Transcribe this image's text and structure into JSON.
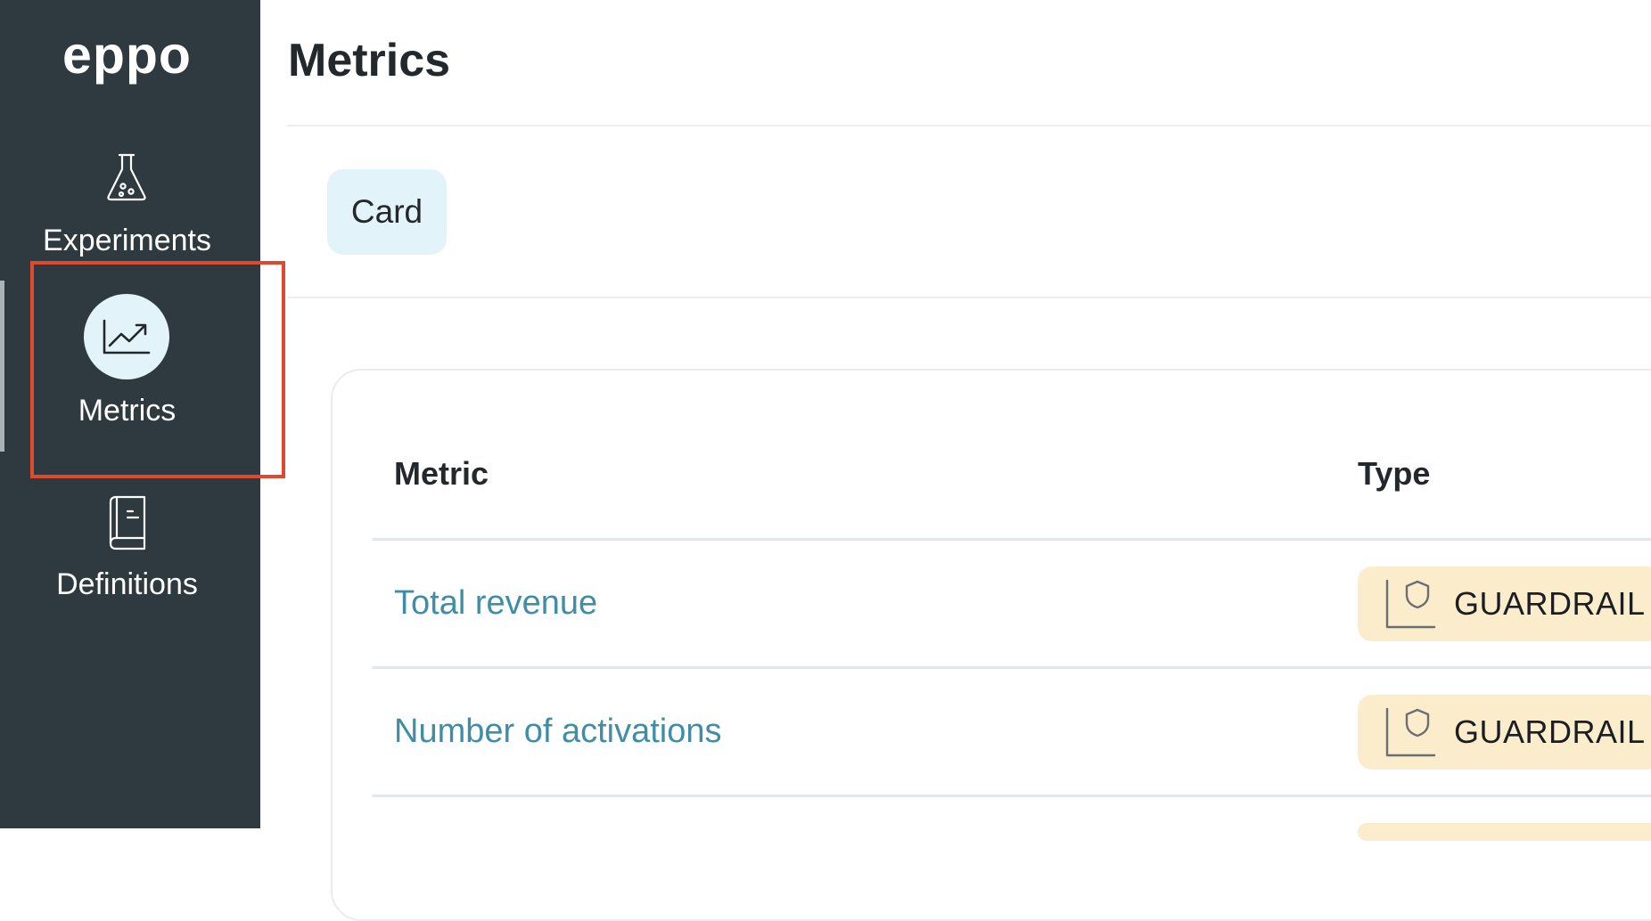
{
  "app": {
    "logo_text": "eppo"
  },
  "sidebar": {
    "items": [
      {
        "label": "Experiments",
        "icon": "flask-icon",
        "active": false
      },
      {
        "label": "Metrics",
        "icon": "trending-chart-icon",
        "active": true
      },
      {
        "label": "Definitions",
        "icon": "book-icon",
        "active": false
      }
    ]
  },
  "header": {
    "title": "Metrics"
  },
  "view_toggle": {
    "label": "Card"
  },
  "table": {
    "columns": [
      "Metric",
      "Type"
    ],
    "rows": [
      {
        "metric": "Total revenue",
        "type": "GUARDRAIL"
      },
      {
        "metric": "Number of activations",
        "type": "GUARDRAIL"
      }
    ]
  },
  "colors": {
    "sidebar_bg": "#2e3a3f",
    "active_icon_bg": "#e3f3fa",
    "link": "#3f8ea5",
    "badge_bg": "#fbeccb",
    "highlight": "#e0492b"
  }
}
